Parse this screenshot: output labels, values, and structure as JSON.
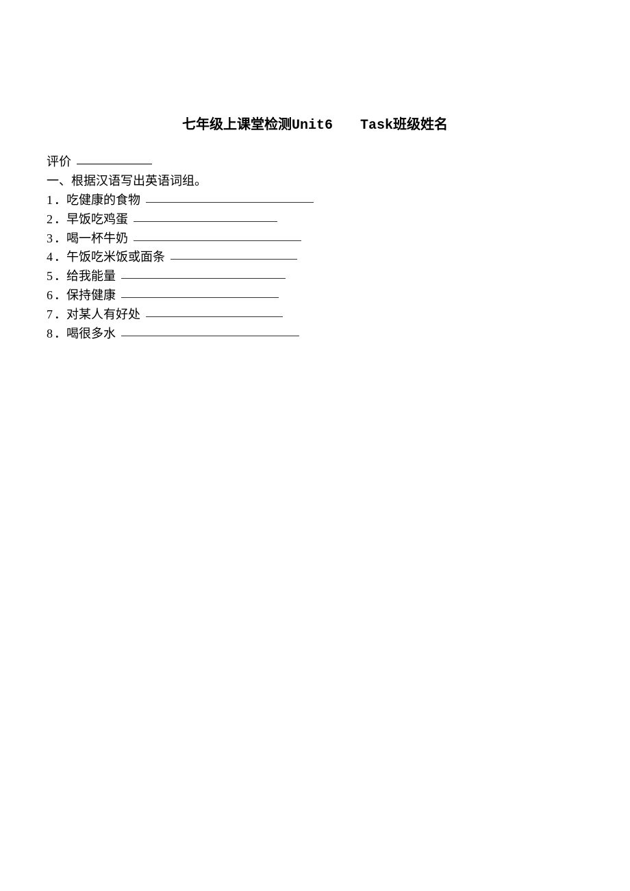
{
  "title": {
    "main": "七年级上课堂检测",
    "unit": "Unit6",
    "task": "Task",
    "suffix": "班级姓名"
  },
  "eval_label": "评价",
  "section_heading": "一、根据汉语写出英语词组。",
  "items": [
    {
      "num": "1",
      "text": "．吃健康的食物"
    },
    {
      "num": "2",
      "text": "．早饭吃鸡蛋"
    },
    {
      "num": "3",
      "text": "．喝一杯牛奶"
    },
    {
      "num": "4",
      "text": "．午饭吃米饭或面条"
    },
    {
      "num": "5",
      "text": "．给我能量"
    },
    {
      "num": "6",
      "text": "．保持健康"
    },
    {
      "num": "7",
      "text": "．对某人有好处"
    },
    {
      "num": "8",
      "text": "．喝很多水"
    }
  ]
}
